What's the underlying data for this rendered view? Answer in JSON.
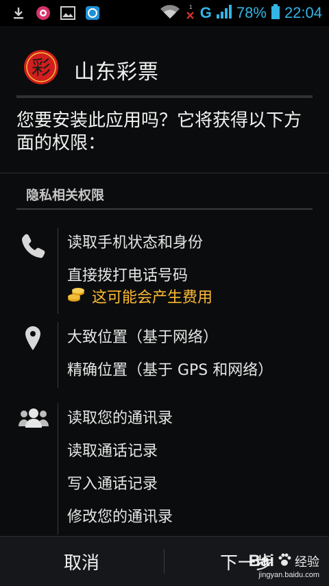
{
  "status_bar": {
    "icons": [
      "download-icon",
      "message-app-icon",
      "image-icon",
      "app-notification-icon"
    ],
    "network_type": "G",
    "battery": "78%",
    "time": "22:04",
    "accent_color": "#33b5e5"
  },
  "app": {
    "name": "山东彩票",
    "logo_char": "彩"
  },
  "prompt": "您要安装此应用吗？它将获得以下方面的权限：",
  "section": {
    "title": "隐私相关权限"
  },
  "groups": [
    {
      "icon": "phone-icon",
      "items": [
        "读取手机状态和身份",
        "直接拨打电话号码"
      ],
      "warning": "这可能会产生费用"
    },
    {
      "icon": "location-pin-icon",
      "items": [
        "大致位置（基于网络）",
        "精确位置（基于 GPS 和网络）"
      ]
    },
    {
      "icon": "contacts-icon",
      "items": [
        "读取您的通讯录",
        "读取通话记录",
        "写入通话记录",
        "修改您的通讯录"
      ]
    }
  ],
  "buttons": {
    "cancel": "取消",
    "next": "下一步"
  },
  "watermark": {
    "brand": "Bai",
    "text": "经验",
    "url": "jingyan.baidu.com"
  },
  "colors": {
    "warning": "#ffbb33",
    "background": "#0b0c0d"
  }
}
